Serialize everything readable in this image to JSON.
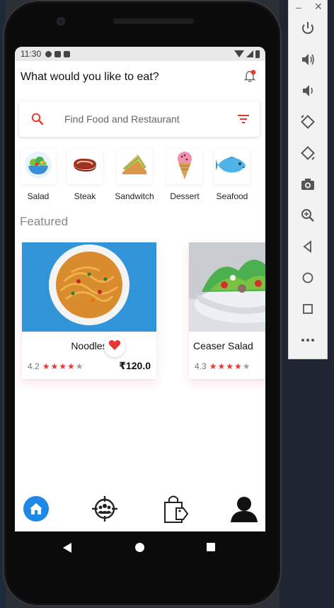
{
  "status_bar": {
    "time": "11:30"
  },
  "header": {
    "title": "What would you like to eat?"
  },
  "search": {
    "placeholder": "Find Food and Restaurant"
  },
  "categories": [
    {
      "label": "Salad",
      "icon": "salad-icon"
    },
    {
      "label": "Steak",
      "icon": "steak-icon"
    },
    {
      "label": "Sandwitch",
      "icon": "sandwich-icon"
    },
    {
      "label": "Dessert",
      "icon": "ice-cream-icon"
    },
    {
      "label": "Seafood",
      "icon": "fish-icon"
    }
  ],
  "featured": {
    "title": "Featured",
    "items": [
      {
        "name": "Noodles",
        "rating": "4.2",
        "stars": 4,
        "price": "₹120.0",
        "favorited": true
      },
      {
        "name": "Ceaser Salad",
        "rating": "4.3",
        "stars": 4,
        "price": "",
        "favorited": false
      }
    ]
  },
  "bottom_nav": [
    "home-icon",
    "community-target-icon",
    "shopping-bag-icon",
    "profile-icon"
  ],
  "colors": {
    "accent": "#e53935",
    "nav_active": "#1e88e5"
  },
  "emulator_toolbar": [
    "power-icon",
    "volume-up-icon",
    "volume-down-icon",
    "rotate-left-icon",
    "rotate-right-icon",
    "camera-icon",
    "zoom-icon",
    "back-icon",
    "home-circle-icon",
    "overview-icon",
    "more-icon"
  ]
}
